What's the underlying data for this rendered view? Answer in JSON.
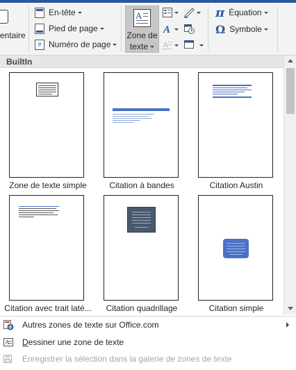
{
  "ribbon": {
    "comment_label": "entaire",
    "header_footer": {
      "header_label": "En-tête",
      "footer_label": "Pied de page",
      "page_number_label": "Numéro de page"
    },
    "text_box_button": {
      "label_line1": "Zone de",
      "label_line2": "texte"
    },
    "symbols": {
      "equation_label": "Équation",
      "symbol_label": "Symbole",
      "equation_icon": "π",
      "symbol_icon": "Ω"
    }
  },
  "gallery": {
    "header": "BuiltIn",
    "items": [
      {
        "label": "Zone de texte simple"
      },
      {
        "label": "Citation à bandes"
      },
      {
        "label": "Citation Austin"
      },
      {
        "label": "Citation avec trait laté..."
      },
      {
        "label": "Citation quadrillage"
      },
      {
        "label": "Citation simple"
      }
    ]
  },
  "menu": {
    "more_label": "Autres zones de texte sur Office.com",
    "draw_label_u": "D",
    "draw_label_rest": "essiner une zone de texte",
    "save_label": "Enregistrer la sélection dans la galerie de zones de texte"
  },
  "colors": {
    "accent": "#2b579a",
    "ribbon_bg": "#f3f3f3",
    "selected_btn": "#c6c6c6",
    "quote_band": "#4a72c4",
    "grid_box": "#4a5a6e",
    "simple_box": "#4a72c4"
  }
}
